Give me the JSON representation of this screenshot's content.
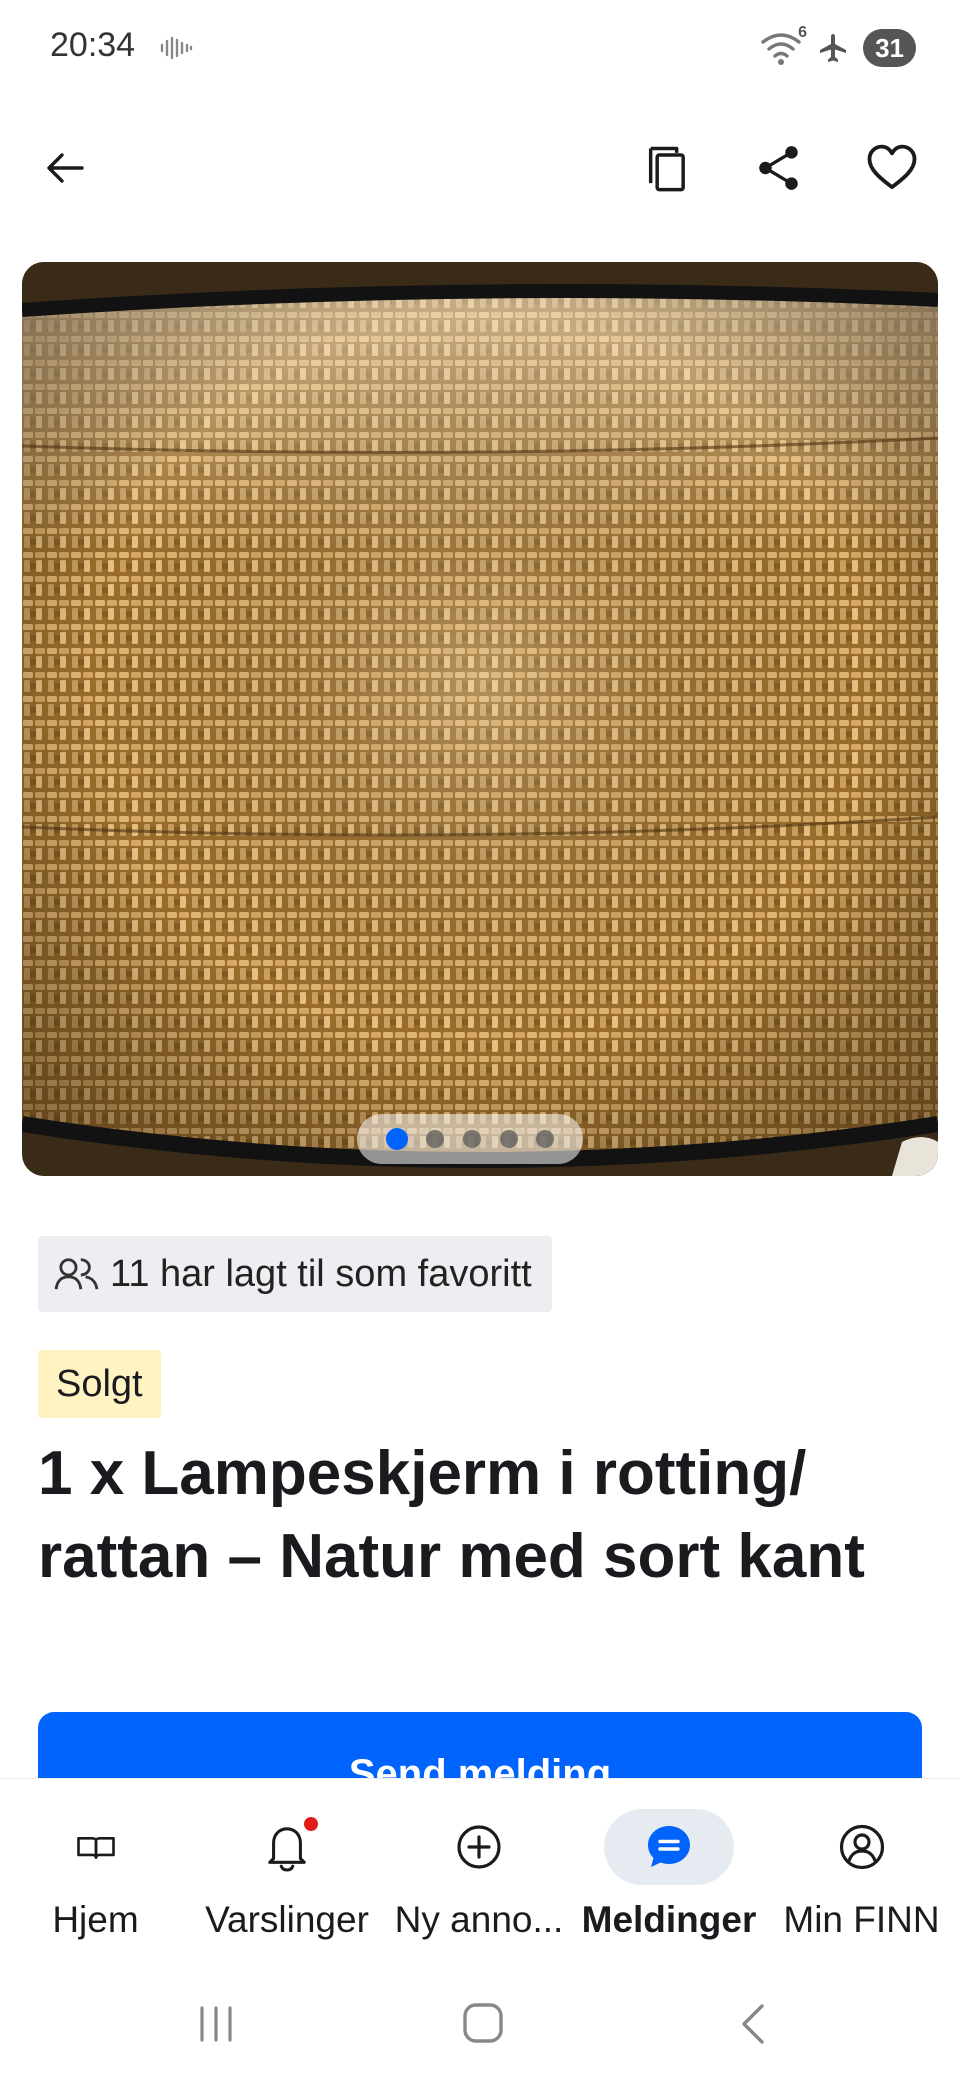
{
  "status_bar": {
    "time": "20:34",
    "wifi_badge": "6",
    "battery": "31",
    "icons": [
      "voice-wave-icon",
      "wifi-icon",
      "airplane-icon"
    ]
  },
  "top_bar": {
    "icons": [
      "back-arrow-icon",
      "copy-icon",
      "share-icon",
      "heart-icon"
    ]
  },
  "carousel": {
    "image_subject": "rattan lampshade",
    "total_images": 5,
    "current_index": 1
  },
  "listing": {
    "favorites_text": "11 har lagt til som favoritt",
    "status_badge": "Solgt",
    "title": "1 x Lampeskjerm i rotting/ rattan – Natur med sort kant",
    "send_button": "Send melding"
  },
  "bottom_nav": {
    "items": [
      {
        "label": "Hjem",
        "icon": "book-icon"
      },
      {
        "label": "Varslinger",
        "icon": "bell-icon"
      },
      {
        "label": "Ny anno...",
        "icon": "plus-circle-icon"
      },
      {
        "label": "Meldinger",
        "icon": "chat-icon"
      },
      {
        "label": "Min FINN",
        "icon": "user-circle-icon"
      }
    ],
    "active": "Meldinger"
  },
  "colors": {
    "primary": "#0063fb",
    "sold_badge_bg": "#fff3c2",
    "chip_bg": "#eeeef2",
    "notification": "#e31b1b"
  }
}
